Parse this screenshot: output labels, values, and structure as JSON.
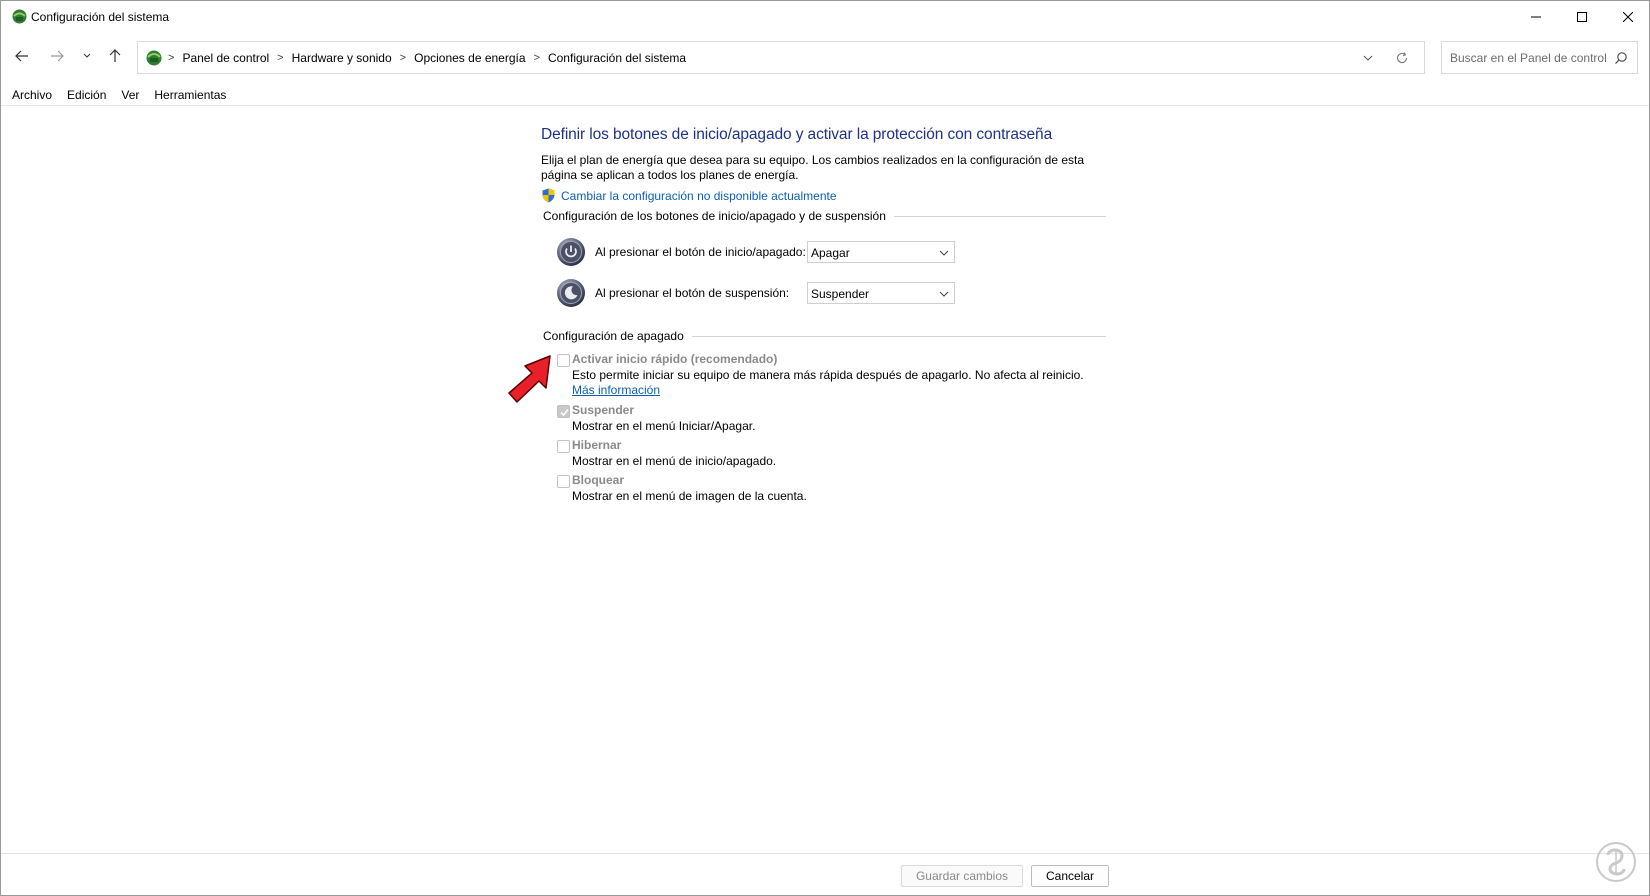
{
  "window": {
    "title": "Configuración del sistema"
  },
  "breadcrumb": [
    "Panel de control",
    "Hardware y sonido",
    "Opciones de energía",
    "Configuración del sistema"
  ],
  "search": {
    "placeholder": "Buscar en el Panel de control"
  },
  "menu": [
    "Archivo",
    "Edición",
    "Ver",
    "Herramientas"
  ],
  "content": {
    "heading": "Definir los botones de inicio/apagado y activar la protección con contraseña",
    "description": "Elija el plan de energía que desea para su equipo. Los cambios realizados en la configuración de esta página se aplican a todos los planes de energía.",
    "uac_link": "Cambiar la configuración no disponible actualmente",
    "buttons_group": {
      "title": "Configuración de los botones de inicio/apagado y de suspensión",
      "rows": [
        {
          "label": "Al presionar el botón de inicio/apagado:",
          "value": "Apagar",
          "icon": "power-icon"
        },
        {
          "label": "Al presionar el botón de suspensión:",
          "value": "Suspender",
          "icon": "sleep-icon"
        }
      ]
    },
    "shutdown_group": {
      "title": "Configuración de apagado",
      "options": [
        {
          "label": "Activar inicio rápido (recomendado)",
          "desc": "Esto permite iniciar su equipo de manera más rápida después de apagarlo. No afecta al reinicio.",
          "link": "Más información",
          "checked": false
        },
        {
          "label": "Suspender",
          "desc": "Mostrar en el menú Iniciar/Apagar.",
          "checked": true
        },
        {
          "label": "Hibernar",
          "desc": "Mostrar en el menú de inicio/apagado.",
          "checked": false
        },
        {
          "label": "Bloquear",
          "desc": "Mostrar en el menú de imagen de la cuenta.",
          "checked": false
        }
      ]
    }
  },
  "footer": {
    "save": "Guardar cambios",
    "cancel": "Cancelar"
  },
  "colors": {
    "heading": "#1e3287",
    "link": "#0a5fb4",
    "annotation": "#e8202a"
  }
}
